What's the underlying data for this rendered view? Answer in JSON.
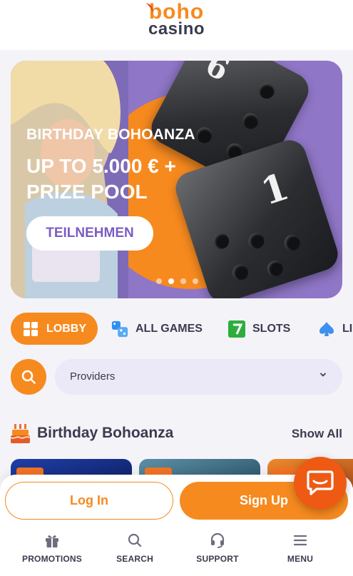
{
  "brand": {
    "logo_top": "boho",
    "logo_bottom": "casino",
    "orange": "#f68a1f",
    "purple": "#8f76c6",
    "dark": "#3b3b4f"
  },
  "banner": {
    "subtitle": "BIRTHDAY BOHOANZA",
    "title": "UP TO 5.000 € + PRIZE POOL",
    "cta_label": "TEILNEHMEN",
    "die_top_number": "6",
    "die_bottom_number": "1",
    "slides_total": 4,
    "active_slide": 2
  },
  "categories": [
    {
      "label": "LOBBY",
      "icon": "lobby-grid-icon",
      "active": true
    },
    {
      "label": "ALL GAMES",
      "icon": "dice-icon",
      "active": false
    },
    {
      "label": "SLOTS",
      "icon": "seven-icon",
      "active": false
    },
    {
      "label": "LI",
      "icon": "spade-icon",
      "active": false
    }
  ],
  "search": {
    "icon": "search-icon",
    "providers_label": "Providers"
  },
  "section": {
    "icon": "cake-icon",
    "title": "Birthday Bohoanza",
    "show_all": "Show All"
  },
  "auth": {
    "login_label": "Log In",
    "signup_label": "Sign Up"
  },
  "bottom_nav": [
    {
      "label": "PROMOTIONS",
      "icon": "gift-icon"
    },
    {
      "label": "SEARCH",
      "icon": "search-icon"
    },
    {
      "label": "SUPPORT",
      "icon": "headset-icon"
    },
    {
      "label": "MENU",
      "icon": "hamburger-icon"
    }
  ],
  "chat": {
    "icon": "chat-icon"
  }
}
